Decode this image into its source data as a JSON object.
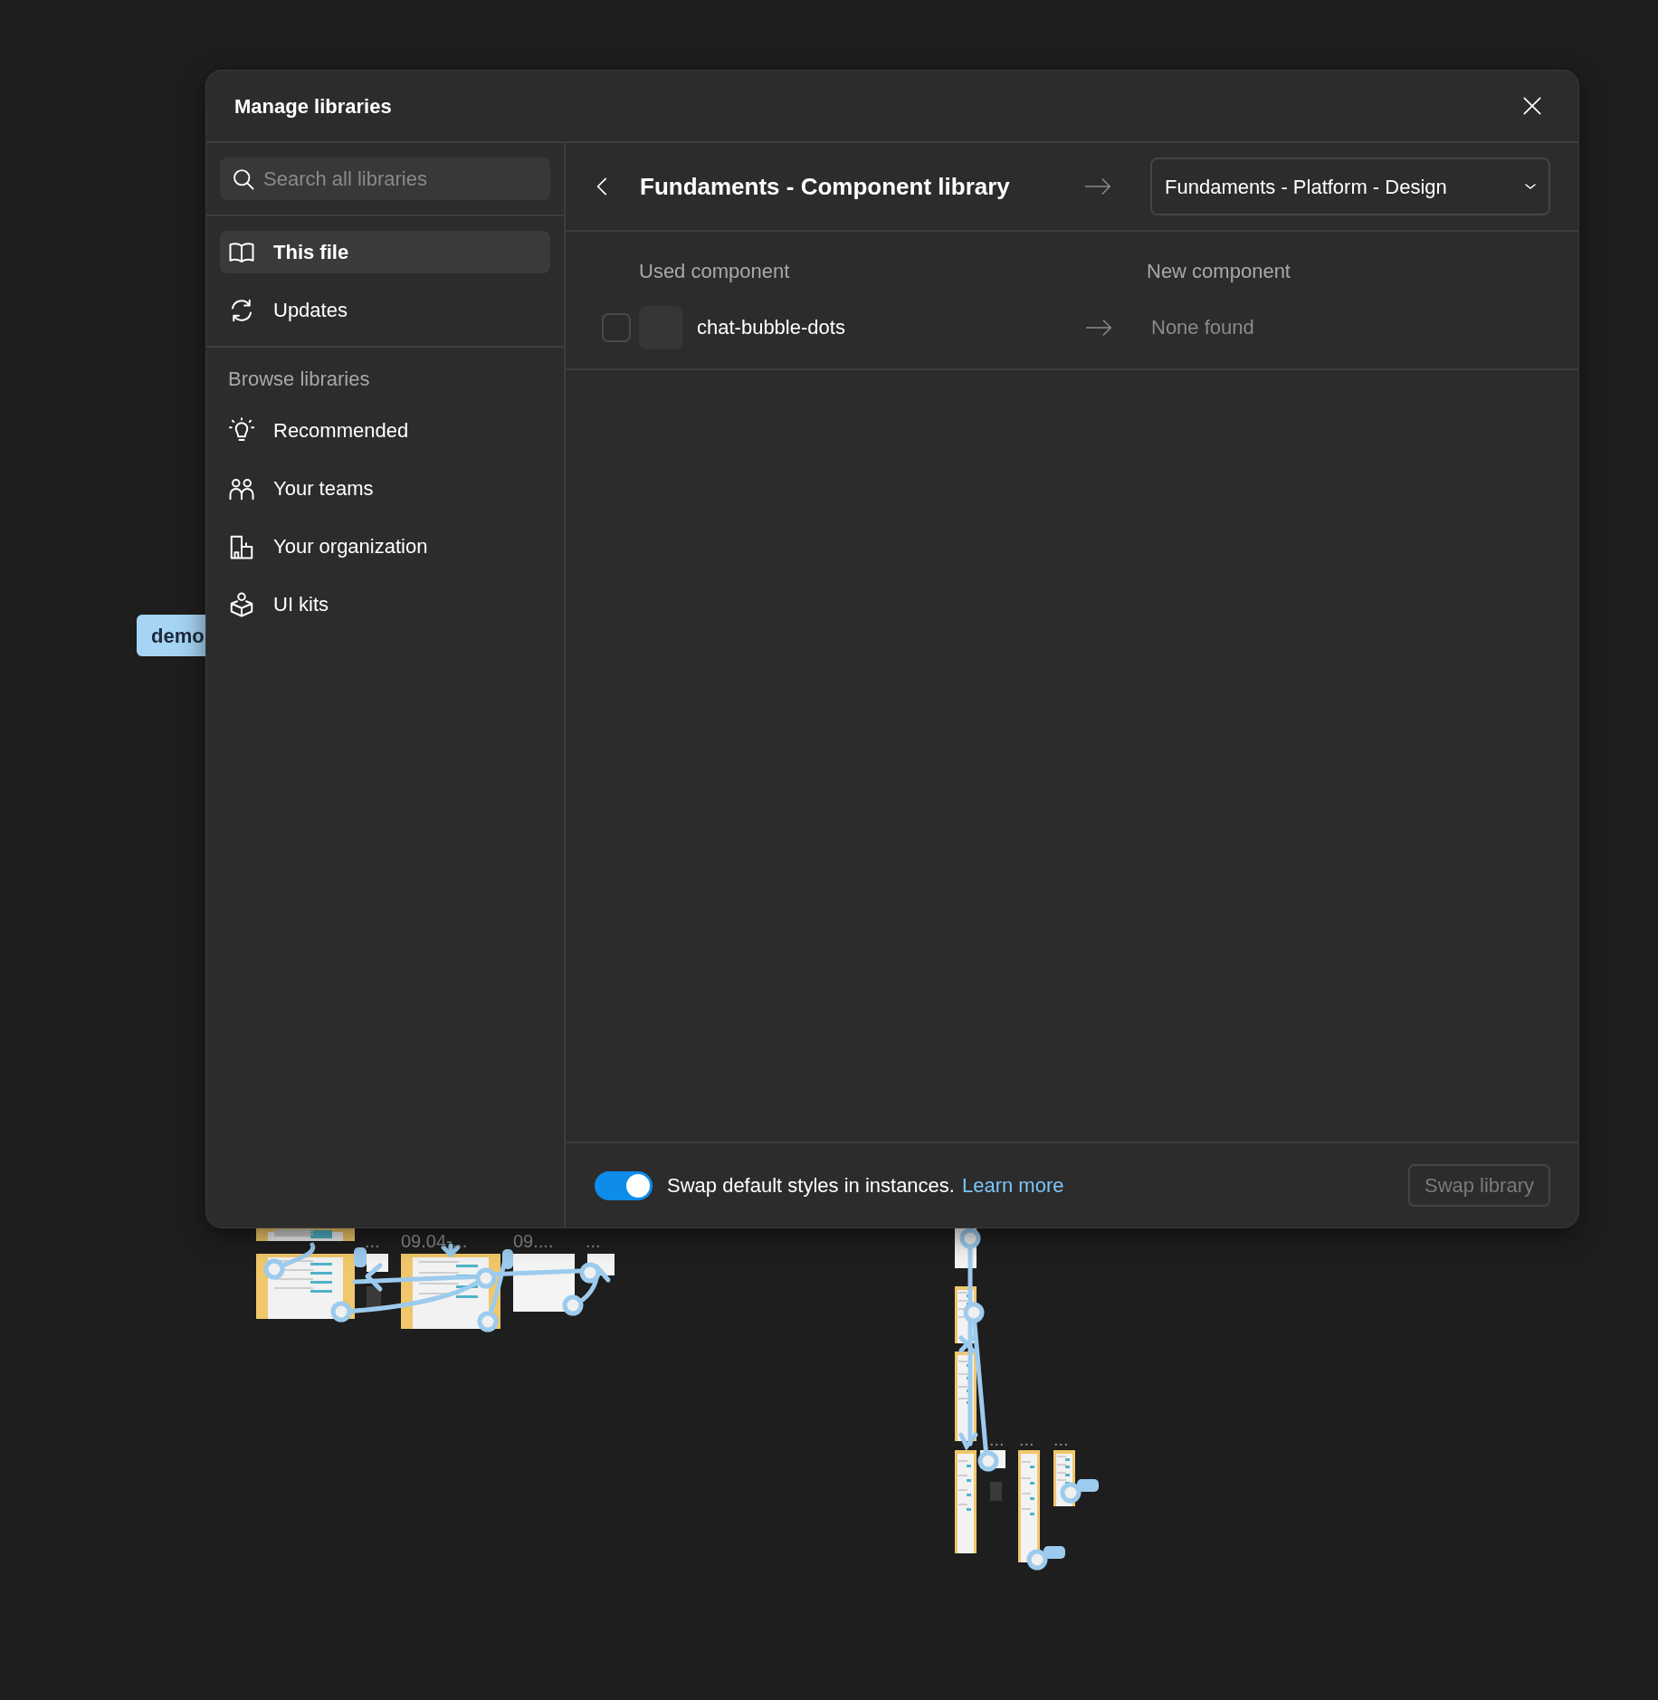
{
  "canvas": {
    "badge": "demo",
    "labels": [
      {
        "text": "..."
      },
      {
        "text": "09.04-..."
      },
      {
        "text": "09...."
      },
      {
        "text": "..."
      },
      {
        "text": "..."
      },
      {
        "text": "..."
      },
      {
        "text": "..."
      }
    ]
  },
  "dialog": {
    "title": "Manage libraries",
    "search": {
      "placeholder": "Search all libraries"
    },
    "nav": [
      {
        "label": "This file",
        "kind": "book",
        "selected": true
      },
      {
        "label": "Updates",
        "kind": "refresh",
        "selected": false
      }
    ],
    "browse": {
      "heading": "Browse libraries",
      "items": [
        {
          "label": "Recommended",
          "kind": "bulb"
        },
        {
          "label": "Your teams",
          "kind": "people"
        },
        {
          "label": "Your organization",
          "kind": "building"
        },
        {
          "label": "UI kits",
          "kind": "box"
        }
      ]
    },
    "swap": {
      "from": "Fundaments - Component library",
      "to": "Fundaments - Platform - Design"
    },
    "columns": [
      "Used component",
      "New component"
    ],
    "rows": [
      {
        "name": "chat-bubble-dots",
        "checked": false,
        "replacement": "None found"
      }
    ],
    "footer": {
      "toggle_on": true,
      "text": "Swap default styles in instances.",
      "link": "Learn more",
      "button": {
        "label": "Swap library",
        "disabled": true
      }
    }
  }
}
